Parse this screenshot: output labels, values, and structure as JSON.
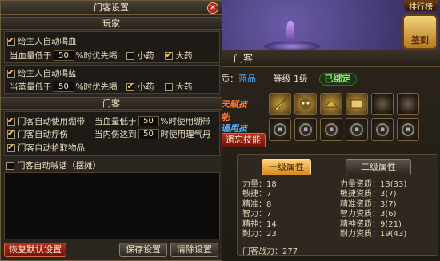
{
  "background": {
    "top_icon_label": "排行榜",
    "event_icon_label": "签到"
  },
  "mk_panel": {
    "title": "门客",
    "quality_label": "质：",
    "quality_value": "蓝品",
    "level_label": "等级",
    "level_value": "1级",
    "bind_badge": "已绑定",
    "skill_label_1": "天赋技能",
    "skill_label_2": "通用技能",
    "forget_button": "遗忘技能",
    "tab_primary": "一级属性",
    "tab_secondary": "二级属性",
    "attributes": [
      {
        "name": "力量",
        "value": "18"
      },
      {
        "name": "敏捷",
        "value": "7"
      },
      {
        "name": "精准",
        "value": "8"
      },
      {
        "name": "智力",
        "value": "7"
      },
      {
        "name": "精神",
        "value": "14"
      },
      {
        "name": "耐力",
        "value": "23"
      }
    ],
    "aptitudes": [
      {
        "name": "力量资质",
        "value": "13(33)"
      },
      {
        "name": "敏捷资质",
        "value": "3(7)"
      },
      {
        "name": "精准资质",
        "value": "3(7)"
      },
      {
        "name": "智力资质",
        "value": "3(6)"
      },
      {
        "name": "精神资质",
        "value": "9(21)"
      },
      {
        "name": "耐力资质",
        "value": "19(43)"
      }
    ],
    "power_label": "门客战力",
    "power_value": "277"
  },
  "dialog": {
    "title": "门客设置",
    "section_player": "玩家",
    "section_mk": "门客",
    "hp_title": "给主人自动喝血",
    "hp_prefix": "当血量低于",
    "hp_value": "50",
    "hp_suffix": "%时优先喝",
    "hp_small": "小药",
    "hp_big": "大药",
    "mp_title": "给主人自动喝蓝",
    "mp_prefix": "当蓝量低于",
    "mp_value": "50",
    "mp_suffix": "%时优先喝",
    "mp_small": "小药",
    "mp_big": "大药",
    "mk_bandage": "门客自动使用绷带",
    "mk_bandage_prefix": "当血量低于",
    "mk_bandage_value": "50",
    "mk_bandage_suffix": "%时使用绷带",
    "mk_heal": "门客自动疗伤",
    "mk_heal_prefix": "当内伤达到",
    "mk_heal_value": "50",
    "mk_heal_suffix": "时使用理气丹",
    "mk_pickup": "门客自动拾取物品",
    "mk_shout": "门客自动喊话（摆摊）",
    "btn_reset": "恢复默认设置",
    "btn_save": "保存设置",
    "btn_clear": "清除设置"
  }
}
